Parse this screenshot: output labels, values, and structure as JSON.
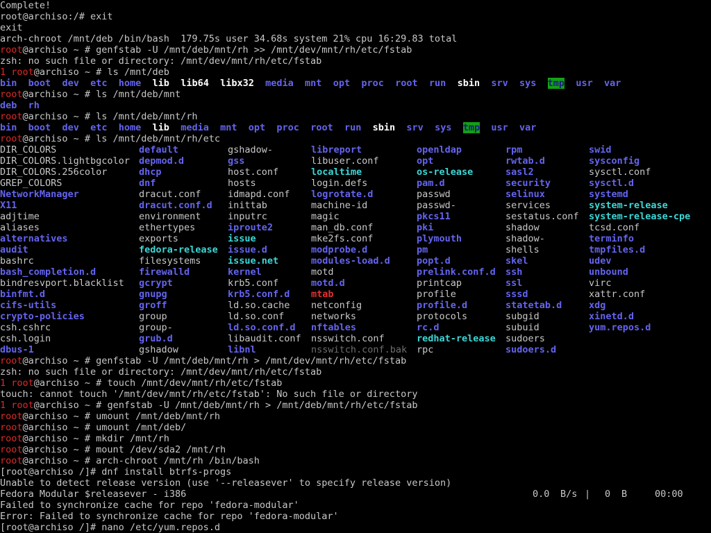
{
  "terminal": {
    "lines": [
      [
        {
          "t": "Complete!",
          "c": "plain"
        }
      ],
      [
        {
          "t": "root@archiso:/# exit",
          "c": "plain"
        }
      ],
      [
        {
          "t": "exit",
          "c": "plain"
        }
      ],
      [
        {
          "t": "arch-chroot /mnt/deb /bin/bash  179.75s user 34.68s system 21% cpu 16:29.83 total",
          "c": "plain"
        }
      ],
      [
        {
          "t": "root",
          "c": "red"
        },
        {
          "t": "@archiso ~ # genfstab -U /mnt/deb/mnt/rh >> /mnt/dev/mnt/rh/etc/fstab",
          "c": "plain"
        }
      ],
      [
        {
          "t": "zsh: no such file or directory: /mnt/dev/mnt/rh/etc/fstab",
          "c": "plain"
        }
      ],
      [
        {
          "t": "1 ",
          "c": "red"
        },
        {
          "t": "root",
          "c": "red"
        },
        {
          "t": "@archiso ~ # ls /mnt/deb",
          "c": "plain"
        }
      ],
      [
        {
          "t": "bin",
          "c": "blue"
        },
        {
          "t": "  ",
          "c": "plain"
        },
        {
          "t": "boot",
          "c": "blue"
        },
        {
          "t": "  ",
          "c": "plain"
        },
        {
          "t": "dev",
          "c": "blue"
        },
        {
          "t": "  ",
          "c": "plain"
        },
        {
          "t": "etc",
          "c": "blue"
        },
        {
          "t": "  ",
          "c": "plain"
        },
        {
          "t": "home",
          "c": "blue"
        },
        {
          "t": "  ",
          "c": "plain"
        },
        {
          "t": "lib",
          "c": "white"
        },
        {
          "t": "  ",
          "c": "plain"
        },
        {
          "t": "lib64",
          "c": "white"
        },
        {
          "t": "  ",
          "c": "plain"
        },
        {
          "t": "libx32",
          "c": "white"
        },
        {
          "t": "  ",
          "c": "plain"
        },
        {
          "t": "media",
          "c": "blue"
        },
        {
          "t": "  ",
          "c": "plain"
        },
        {
          "t": "mnt",
          "c": "blue"
        },
        {
          "t": "  ",
          "c": "plain"
        },
        {
          "t": "opt",
          "c": "blue"
        },
        {
          "t": "  ",
          "c": "plain"
        },
        {
          "t": "proc",
          "c": "blue"
        },
        {
          "t": "  ",
          "c": "plain"
        },
        {
          "t": "root",
          "c": "blue"
        },
        {
          "t": "  ",
          "c": "plain"
        },
        {
          "t": "run",
          "c": "blue"
        },
        {
          "t": "  ",
          "c": "plain"
        },
        {
          "t": "sbin",
          "c": "white"
        },
        {
          "t": "  ",
          "c": "plain"
        },
        {
          "t": "srv",
          "c": "blue"
        },
        {
          "t": "  ",
          "c": "plain"
        },
        {
          "t": "sys",
          "c": "blue"
        },
        {
          "t": "  ",
          "c": "plain"
        },
        {
          "t": "tmp",
          "c": "tmp"
        },
        {
          "t": "  ",
          "c": "plain"
        },
        {
          "t": "usr",
          "c": "blue"
        },
        {
          "t": "  ",
          "c": "plain"
        },
        {
          "t": "var",
          "c": "blue"
        }
      ],
      [
        {
          "t": "root",
          "c": "red"
        },
        {
          "t": "@archiso ~ # ls /mnt/deb/mnt",
          "c": "plain"
        }
      ],
      [
        {
          "t": "deb",
          "c": "blue"
        },
        {
          "t": "  ",
          "c": "plain"
        },
        {
          "t": "rh",
          "c": "blue"
        }
      ],
      [
        {
          "t": "root",
          "c": "red"
        },
        {
          "t": "@archiso ~ # ls /mnt/deb/mnt/rh",
          "c": "plain"
        }
      ],
      [
        {
          "t": "bin",
          "c": "blue"
        },
        {
          "t": "  ",
          "c": "plain"
        },
        {
          "t": "boot",
          "c": "blue"
        },
        {
          "t": "  ",
          "c": "plain"
        },
        {
          "t": "dev",
          "c": "blue"
        },
        {
          "t": "  ",
          "c": "plain"
        },
        {
          "t": "etc",
          "c": "blue"
        },
        {
          "t": "  ",
          "c": "plain"
        },
        {
          "t": "home",
          "c": "blue"
        },
        {
          "t": "  ",
          "c": "plain"
        },
        {
          "t": "lib",
          "c": "white"
        },
        {
          "t": "  ",
          "c": "plain"
        },
        {
          "t": "media",
          "c": "blue"
        },
        {
          "t": "  ",
          "c": "plain"
        },
        {
          "t": "mnt",
          "c": "blue"
        },
        {
          "t": "  ",
          "c": "plain"
        },
        {
          "t": "opt",
          "c": "blue"
        },
        {
          "t": "  ",
          "c": "plain"
        },
        {
          "t": "proc",
          "c": "blue"
        },
        {
          "t": "  ",
          "c": "plain"
        },
        {
          "t": "root",
          "c": "blue"
        },
        {
          "t": "  ",
          "c": "plain"
        },
        {
          "t": "run",
          "c": "blue"
        },
        {
          "t": "  ",
          "c": "plain"
        },
        {
          "t": "sbin",
          "c": "white"
        },
        {
          "t": "  ",
          "c": "plain"
        },
        {
          "t": "srv",
          "c": "blue"
        },
        {
          "t": "  ",
          "c": "plain"
        },
        {
          "t": "sys",
          "c": "blue"
        },
        {
          "t": "  ",
          "c": "plain"
        },
        {
          "t": "tmp",
          "c": "tmp"
        },
        {
          "t": "  ",
          "c": "plain"
        },
        {
          "t": "usr",
          "c": "blue"
        },
        {
          "t": "  ",
          "c": "plain"
        },
        {
          "t": "var",
          "c": "blue"
        }
      ],
      [
        {
          "t": "root",
          "c": "red"
        },
        {
          "t": "@archiso ~ # ls /mnt/deb/mnt/rh/etc",
          "c": "plain"
        }
      ]
    ],
    "etc_listing": [
      [
        {
          "t": "DIR_COLORS",
          "c": "plain"
        },
        {
          "t": "default",
          "c": "blue"
        },
        {
          "t": "gshadow-",
          "c": "plain"
        },
        {
          "t": "libreport",
          "c": "blue"
        },
        {
          "t": "openldap",
          "c": "blue"
        },
        {
          "t": "rpm",
          "c": "blue"
        },
        {
          "t": "swid",
          "c": "blue"
        }
      ],
      [
        {
          "t": "DIR_COLORS.lightbgcolor",
          "c": "plain"
        },
        {
          "t": "depmod.d",
          "c": "blue"
        },
        {
          "t": "gss",
          "c": "blue"
        },
        {
          "t": "libuser.conf",
          "c": "plain"
        },
        {
          "t": "opt",
          "c": "blue"
        },
        {
          "t": "rwtab.d",
          "c": "blue"
        },
        {
          "t": "sysconfig",
          "c": "blue"
        }
      ],
      [
        {
          "t": "DIR_COLORS.256color",
          "c": "plain"
        },
        {
          "t": "dhcp",
          "c": "blue"
        },
        {
          "t": "host.conf",
          "c": "plain"
        },
        {
          "t": "localtime",
          "c": "cyan"
        },
        {
          "t": "os-release",
          "c": "cyan"
        },
        {
          "t": "sasl2",
          "c": "blue"
        },
        {
          "t": "sysctl.conf",
          "c": "plain"
        }
      ],
      [
        {
          "t": "GREP_COLORS",
          "c": "plain"
        },
        {
          "t": "dnf",
          "c": "blue"
        },
        {
          "t": "hosts",
          "c": "plain"
        },
        {
          "t": "login.defs",
          "c": "plain"
        },
        {
          "t": "pam.d",
          "c": "blue"
        },
        {
          "t": "security",
          "c": "blue"
        },
        {
          "t": "sysctl.d",
          "c": "blue"
        }
      ],
      [
        {
          "t": "NetworkManager",
          "c": "blue"
        },
        {
          "t": "dracut.conf",
          "c": "plain"
        },
        {
          "t": "idmapd.conf",
          "c": "plain"
        },
        {
          "t": "logrotate.d",
          "c": "blue"
        },
        {
          "t": "passwd",
          "c": "plain"
        },
        {
          "t": "selinux",
          "c": "blue"
        },
        {
          "t": "systemd",
          "c": "blue"
        }
      ],
      [
        {
          "t": "X11",
          "c": "blue"
        },
        {
          "t": "dracut.conf.d",
          "c": "blue"
        },
        {
          "t": "inittab",
          "c": "plain"
        },
        {
          "t": "machine-id",
          "c": "plain"
        },
        {
          "t": "passwd-",
          "c": "plain"
        },
        {
          "t": "services",
          "c": "plain"
        },
        {
          "t": "system-release",
          "c": "cyan"
        }
      ],
      [
        {
          "t": "adjtime",
          "c": "plain"
        },
        {
          "t": "environment",
          "c": "plain"
        },
        {
          "t": "inputrc",
          "c": "plain"
        },
        {
          "t": "magic",
          "c": "plain"
        },
        {
          "t": "pkcs11",
          "c": "blue"
        },
        {
          "t": "sestatus.conf",
          "c": "plain"
        },
        {
          "t": "system-release-cpe",
          "c": "cyan"
        }
      ],
      [
        {
          "t": "aliases",
          "c": "plain"
        },
        {
          "t": "ethertypes",
          "c": "plain"
        },
        {
          "t": "iproute2",
          "c": "blue"
        },
        {
          "t": "man_db.conf",
          "c": "plain"
        },
        {
          "t": "pki",
          "c": "blue"
        },
        {
          "t": "shadow",
          "c": "plain"
        },
        {
          "t": "tcsd.conf",
          "c": "plain"
        }
      ],
      [
        {
          "t": "alternatives",
          "c": "blue"
        },
        {
          "t": "exports",
          "c": "plain"
        },
        {
          "t": "issue",
          "c": "cyan"
        },
        {
          "t": "mke2fs.conf",
          "c": "plain"
        },
        {
          "t": "plymouth",
          "c": "blue"
        },
        {
          "t": "shadow-",
          "c": "plain"
        },
        {
          "t": "terminfo",
          "c": "blue"
        }
      ],
      [
        {
          "t": "audit",
          "c": "blue"
        },
        {
          "t": "fedora-release",
          "c": "cyan"
        },
        {
          "t": "issue.d",
          "c": "blue"
        },
        {
          "t": "modprobe.d",
          "c": "blue"
        },
        {
          "t": "pm",
          "c": "blue"
        },
        {
          "t": "shells",
          "c": "plain"
        },
        {
          "t": "tmpfiles.d",
          "c": "blue"
        }
      ],
      [
        {
          "t": "bashrc",
          "c": "plain"
        },
        {
          "t": "filesystems",
          "c": "plain"
        },
        {
          "t": "issue.net",
          "c": "cyan"
        },
        {
          "t": "modules-load.d",
          "c": "blue"
        },
        {
          "t": "popt.d",
          "c": "blue"
        },
        {
          "t": "skel",
          "c": "blue"
        },
        {
          "t": "udev",
          "c": "blue"
        }
      ],
      [
        {
          "t": "bash_completion.d",
          "c": "blue"
        },
        {
          "t": "firewalld",
          "c": "blue"
        },
        {
          "t": "kernel",
          "c": "blue"
        },
        {
          "t": "motd",
          "c": "plain"
        },
        {
          "t": "prelink.conf.d",
          "c": "blue"
        },
        {
          "t": "ssh",
          "c": "blue"
        },
        {
          "t": "unbound",
          "c": "blue"
        }
      ],
      [
        {
          "t": "bindresvport.blacklist",
          "c": "plain"
        },
        {
          "t": "gcrypt",
          "c": "blue"
        },
        {
          "t": "krb5.conf",
          "c": "plain"
        },
        {
          "t": "motd.d",
          "c": "blue"
        },
        {
          "t": "printcap",
          "c": "plain"
        },
        {
          "t": "ssl",
          "c": "blue"
        },
        {
          "t": "virc",
          "c": "plain"
        }
      ],
      [
        {
          "t": "binfmt.d",
          "c": "blue"
        },
        {
          "t": "gnupg",
          "c": "blue"
        },
        {
          "t": "krb5.conf.d",
          "c": "blue"
        },
        {
          "t": "mtab",
          "c": "redb"
        },
        {
          "t": "profile",
          "c": "plain"
        },
        {
          "t": "sssd",
          "c": "blue"
        },
        {
          "t": "xattr.conf",
          "c": "plain"
        }
      ],
      [
        {
          "t": "cifs-utils",
          "c": "blue"
        },
        {
          "t": "groff",
          "c": "blue"
        },
        {
          "t": "ld.so.cache",
          "c": "plain"
        },
        {
          "t": "netconfig",
          "c": "plain"
        },
        {
          "t": "profile.d",
          "c": "blue"
        },
        {
          "t": "statetab.d",
          "c": "blue"
        },
        {
          "t": "xdg",
          "c": "blue"
        }
      ],
      [
        {
          "t": "crypto-policies",
          "c": "blue"
        },
        {
          "t": "group",
          "c": "plain"
        },
        {
          "t": "ld.so.conf",
          "c": "plain"
        },
        {
          "t": "networks",
          "c": "plain"
        },
        {
          "t": "protocols",
          "c": "plain"
        },
        {
          "t": "subgid",
          "c": "plain"
        },
        {
          "t": "xinetd.d",
          "c": "blue"
        }
      ],
      [
        {
          "t": "csh.cshrc",
          "c": "plain"
        },
        {
          "t": "group-",
          "c": "plain"
        },
        {
          "t": "ld.so.conf.d",
          "c": "blue"
        },
        {
          "t": "nftables",
          "c": "blue"
        },
        {
          "t": "rc.d",
          "c": "blue"
        },
        {
          "t": "subuid",
          "c": "plain"
        },
        {
          "t": "yum.repos.d",
          "c": "blue"
        }
      ],
      [
        {
          "t": "csh.login",
          "c": "plain"
        },
        {
          "t": "grub.d",
          "c": "blue"
        },
        {
          "t": "libaudit.conf",
          "c": "plain"
        },
        {
          "t": "nsswitch.conf",
          "c": "plain"
        },
        {
          "t": "redhat-release",
          "c": "cyan"
        },
        {
          "t": "sudoers",
          "c": "plain"
        },
        {
          "t": "",
          "c": "plain"
        }
      ],
      [
        {
          "t": "dbus-1",
          "c": "blue"
        },
        {
          "t": "gshadow",
          "c": "plain"
        },
        {
          "t": "libnl",
          "c": "blue"
        },
        {
          "t": "nsswitch.conf.bak",
          "c": "gray"
        },
        {
          "t": "rpc",
          "c": "plain"
        },
        {
          "t": "sudoers.d",
          "c": "blue"
        },
        {
          "t": "",
          "c": "plain"
        }
      ]
    ],
    "lines_after": [
      [
        {
          "t": "root",
          "c": "red"
        },
        {
          "t": "@archiso ~ # genfstab -U /mnt/deb/mnt/rh > /mnt/dev/mnt/rh/etc/fstab",
          "c": "plain"
        }
      ],
      [
        {
          "t": "zsh: no such file or directory: /mnt/dev/mnt/rh/etc/fstab",
          "c": "plain"
        }
      ],
      [
        {
          "t": "1 ",
          "c": "red"
        },
        {
          "t": "root",
          "c": "red"
        },
        {
          "t": "@archiso ~ # touch /mnt/dev/mnt/rh/etc/fstab",
          "c": "plain"
        }
      ],
      [
        {
          "t": "touch: cannot touch '/mnt/dev/mnt/rh/etc/fstab': No such file or directory",
          "c": "plain"
        }
      ],
      [
        {
          "t": "1 ",
          "c": "red"
        },
        {
          "t": "root",
          "c": "red"
        },
        {
          "t": "@archiso ~ # genfstab -U /mnt/deb/mnt/rh > /mnt/deb/mnt/rh/etc/fstab",
          "c": "plain"
        }
      ],
      [
        {
          "t": "root",
          "c": "red"
        },
        {
          "t": "@archiso ~ # umount /mnt/deb/mnt/rh",
          "c": "plain"
        }
      ],
      [
        {
          "t": "root",
          "c": "red"
        },
        {
          "t": "@archiso ~ # umount /mnt/deb/",
          "c": "plain"
        }
      ],
      [
        {
          "t": "root",
          "c": "red"
        },
        {
          "t": "@archiso ~ # mkdir /mnt/rh",
          "c": "plain"
        }
      ],
      [
        {
          "t": "root",
          "c": "red"
        },
        {
          "t": "@archiso ~ # mount /dev/sda2 /mnt/rh",
          "c": "plain"
        }
      ],
      [
        {
          "t": "root",
          "c": "red"
        },
        {
          "t": "@archiso ~ # arch-chroot /mnt/rh /bin/bash",
          "c": "plain"
        }
      ],
      [
        {
          "t": "[root@archiso /]# dnf install btrfs-progs",
          "c": "plain"
        }
      ],
      [
        {
          "t": "Unable to detect release version (use '--releasever' to specify release version)",
          "c": "plain"
        }
      ],
      [
        {
          "t": "Fedora Modular $releasever - i386",
          "c": "plain"
        }
      ],
      [
        {
          "t": "Failed to synchronize cache for repo 'fedora-modular'",
          "c": "plain"
        }
      ],
      [
        {
          "t": "Error: Failed to synchronize cache for repo 'fedora-modular'",
          "c": "plain"
        }
      ],
      [
        {
          "t": "[root@archiso /]# nano /etc/yum.repos.d",
          "c": "plain"
        }
      ]
    ],
    "progress": {
      "rate": "0.0",
      "rate_unit": "B/s",
      "separator": "|",
      "size": "0",
      "size_unit": "B",
      "eta": "00:00"
    }
  }
}
